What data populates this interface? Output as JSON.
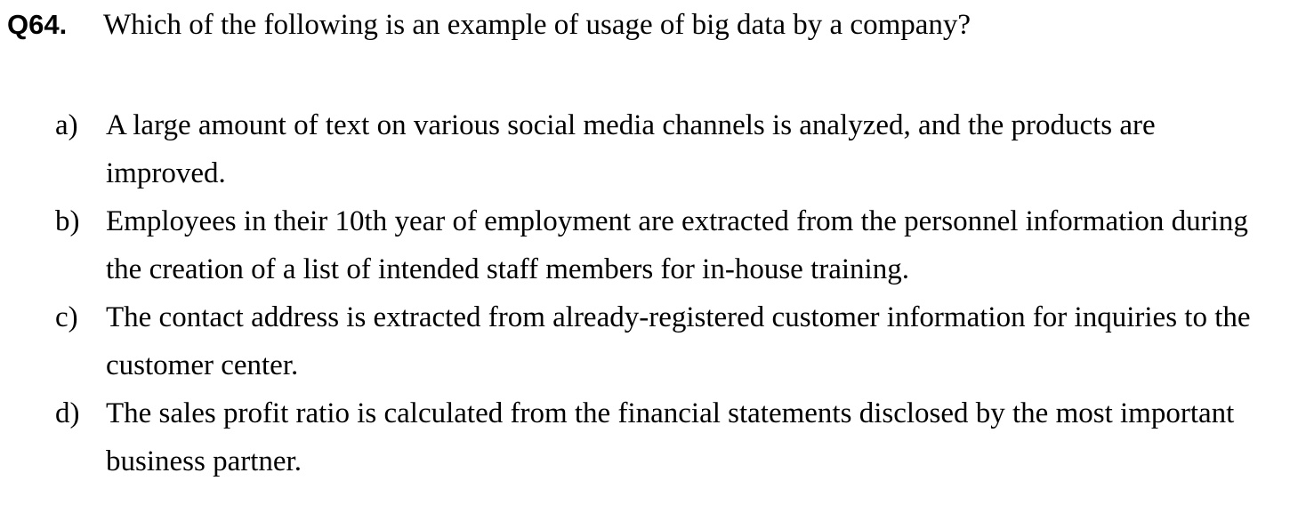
{
  "question": {
    "number": "Q64.",
    "text": "Which of the following is an example of usage of big data by a company?"
  },
  "options": [
    {
      "letter": "a)",
      "text": "A large amount of text on various social media channels is analyzed, and the products are improved."
    },
    {
      "letter": "b)",
      "text": "Employees in their 10th year of employment are extracted from the personnel information during the creation of a list of intended staff members for in-house training."
    },
    {
      "letter": "c)",
      "text": "The contact address is extracted from already-registered customer information for inquiries to the customer center."
    },
    {
      "letter": "d)",
      "text": "The sales profit ratio is calculated from the financial statements disclosed by the most important business partner."
    }
  ]
}
